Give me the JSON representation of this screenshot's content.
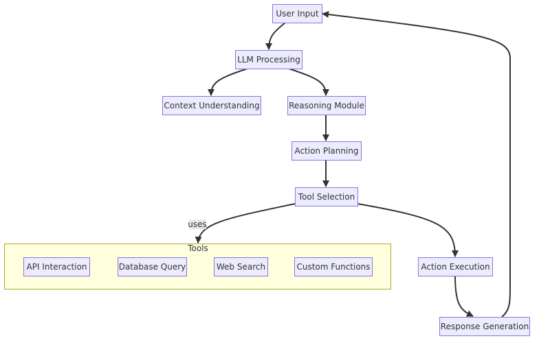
{
  "colors": {
    "node_fill": "#ECECFF",
    "node_stroke": "#9370DB",
    "cluster_fill": "#ffffde",
    "cluster_stroke": "#aaaa33",
    "edge": "#333333"
  },
  "nodes": {
    "user_input": "User Input",
    "llm_processing": "LLM Processing",
    "context_understanding": "Context Understanding",
    "reasoning_module": "Reasoning Module",
    "action_planning": "Action Planning",
    "tool_selection": "Tool Selection",
    "api_interaction": "API Interaction",
    "database_query": "Database Query",
    "web_search": "Web Search",
    "custom_functions": "Custom Functions",
    "action_execution": "Action Execution",
    "response_generation": "Response Generation"
  },
  "cluster": {
    "title": "Tools"
  },
  "edge_labels": {
    "uses": "uses"
  }
}
